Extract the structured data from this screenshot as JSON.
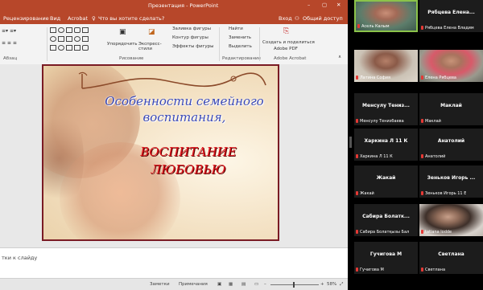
{
  "window": {
    "title": "Презентация - PowerPoint"
  },
  "menu": {
    "items": [
      "Рецензирование",
      "Вид",
      "Acrobat"
    ],
    "tell_me": "Что вы хотите сделать?",
    "signin": "Вход",
    "share": "Общий доступ"
  },
  "ribbon": {
    "group_paragraph": "Абзац",
    "group_drawing": "Рисование",
    "group_editing": "Редактирование",
    "group_acrobat": "Adobe Acrobat",
    "arrange": "Упорядочить",
    "quick_styles": "Экспресс-стили",
    "shape_fill": "Заливка фигуры",
    "shape_outline": "Контур фигуры",
    "shape_effects": "Эффекты фигуры",
    "find": "Найти",
    "replace": "Заменить",
    "select": "Выделить",
    "create_pdf_line1": "Создать и поделиться",
    "create_pdf_line2": "Adobe PDF"
  },
  "slide": {
    "title_line1": "Особенности семейного",
    "title_line2": "воспитания,",
    "subtitle_line1": "ВОСПИТАНИЕ",
    "subtitle_line2": "ЛЮБОВЬЮ"
  },
  "notes": {
    "placeholder": "тки к слайду"
  },
  "status": {
    "notes": "Заметки",
    "comments": "Примечания",
    "zoom": "58%"
  },
  "participants": [
    {
      "name": "",
      "caption": "Асель Калым",
      "video": "person-active"
    },
    {
      "name": "Рябцева Елена...",
      "caption": "Рябцева Елена Владим",
      "video": ""
    },
    {
      "name": "",
      "caption": "Латина София",
      "video": "person"
    },
    {
      "name": "",
      "caption": "Елена Рябцева",
      "video": "person"
    },
    {
      "name": "Менсулу Тениз...",
      "caption": "Менсулу Тенизбаева",
      "video": ""
    },
    {
      "name": "Маклай",
      "caption": "Маклай",
      "video": ""
    },
    {
      "name": "Харкина Л 11 К",
      "caption": "Харкина Л 11 К",
      "video": ""
    },
    {
      "name": "Анатолий",
      "caption": "Анатолий",
      "video": ""
    },
    {
      "name": "Жакай",
      "caption": "Жакай",
      "video": ""
    },
    {
      "name": "Зеньков Игорь ...",
      "caption": "Зеньков Игорь 11 Е",
      "video": ""
    },
    {
      "name": "Сабира Болатк...",
      "caption": "Сабира Болатқызы Бал",
      "video": ""
    },
    {
      "name": "",
      "caption": "tatiana lodde",
      "video": "person"
    },
    {
      "name": "Гучигова М",
      "caption": "Гучигова М",
      "video": ""
    },
    {
      "name": "Светлана",
      "caption": "Светлана",
      "video": ""
    }
  ],
  "colors": {
    "ppt_accent": "#b7472a",
    "slide_title": "#3a49b7",
    "slide_subtitle": "#e0141c",
    "active_speaker": "#8bc34a"
  }
}
